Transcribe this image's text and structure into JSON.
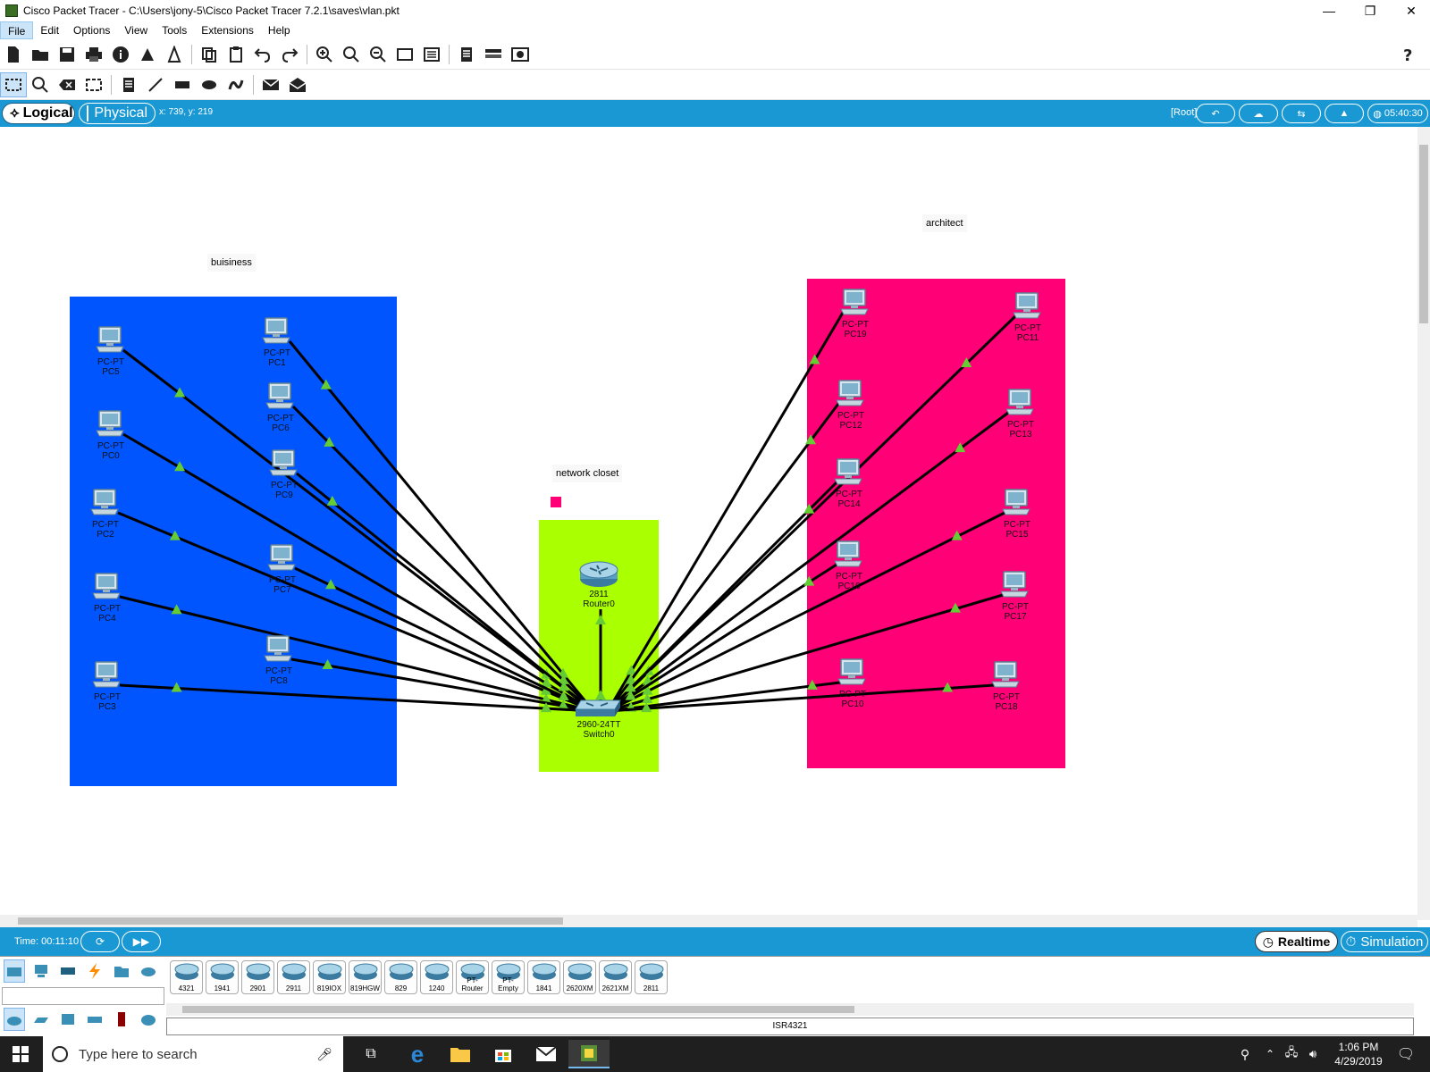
{
  "window": {
    "title": "Cisco Packet Tracer - C:\\Users\\jony-5\\Cisco Packet Tracer 7.2.1\\saves\\vlan.pkt",
    "minimize": "—",
    "maximize": "❐",
    "close": "✕"
  },
  "menu": [
    "File",
    "Edit",
    "Options",
    "View",
    "Tools",
    "Extensions",
    "Help"
  ],
  "workspace_bar": {
    "logical": "Logical",
    "physical": "Physical",
    "coords": "x: 739, y: 219",
    "root": "[Root]",
    "clock": "05:40:30"
  },
  "areas": {
    "business": {
      "label": "buisiness",
      "color": "#0055ff"
    },
    "closet": {
      "label": "network closet",
      "color": "#aaff00"
    },
    "architect": {
      "label": "architect",
      "color": "#ff0077"
    }
  },
  "devices": {
    "pc5": {
      "type": "PC-PT",
      "name": "PC5"
    },
    "pc1": {
      "type": "PC-PT",
      "name": "PC1"
    },
    "pc0": {
      "type": "PC-PT",
      "name": "PC0"
    },
    "pc6": {
      "type": "PC-PT",
      "name": "PC6"
    },
    "pc9": {
      "type": "PC-PT",
      "name": "PC9"
    },
    "pc2": {
      "type": "PC-PT",
      "name": "PC2"
    },
    "pc7": {
      "type": "PC-PT",
      "name": "PC7"
    },
    "pc4": {
      "type": "PC-PT",
      "name": "PC4"
    },
    "pc8": {
      "type": "PC-PT",
      "name": "PC8"
    },
    "pc3": {
      "type": "PC-PT",
      "name": "PC3"
    },
    "pc19": {
      "type": "PC-PT",
      "name": "PC19"
    },
    "pc11": {
      "type": "PC-PT",
      "name": "PC11"
    },
    "pc12": {
      "type": "PC-PT",
      "name": "PC12"
    },
    "pc13": {
      "type": "PC-PT",
      "name": "PC13"
    },
    "pc14": {
      "type": "PC-PT",
      "name": "PC14"
    },
    "pc15": {
      "type": "PC-PT",
      "name": "PC15"
    },
    "pc16": {
      "type": "PC-PT",
      "name": "PC16"
    },
    "pc17": {
      "type": "PC-PT",
      "name": "PC17"
    },
    "pc10": {
      "type": "PC-PT",
      "name": "PC10"
    },
    "pc18": {
      "type": "PC-PT",
      "name": "PC18"
    },
    "router0": {
      "type": "2811",
      "name": "Router0"
    },
    "switch0": {
      "type": "2960-24TT",
      "name": "Switch0"
    }
  },
  "link_status_color": "#66cc33",
  "bottom_bar": {
    "time": "Time: 00:11:10",
    "realtime": "Realtime",
    "simulation": "Simulation"
  },
  "palette": {
    "models": [
      "4321",
      "1941",
      "2901",
      "2911",
      "819IOX",
      "819HGW",
      "829",
      "1240",
      "PT-Router",
      "PT-Empty",
      "1841",
      "2620XM",
      "2621XM",
      "2811"
    ],
    "selected_model": "ISR4321"
  },
  "taskbar": {
    "search_placeholder": "Type here to search",
    "time": "1:06 PM",
    "date": "4/29/2019"
  }
}
